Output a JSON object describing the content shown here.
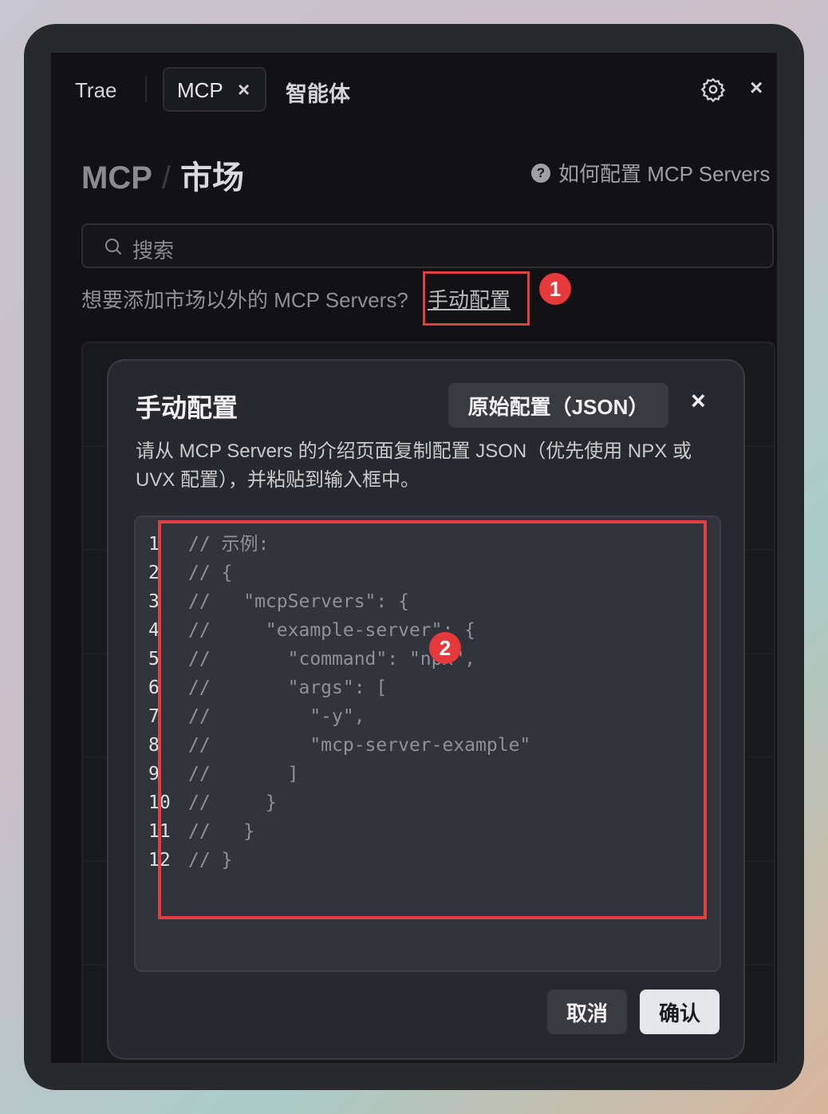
{
  "tabs": {
    "trae": "Trae",
    "mcp": "MCP",
    "mcp_close": "×",
    "agent": "智能体"
  },
  "window": {
    "close": "×"
  },
  "heading": {
    "mcp": "MCP",
    "separator": "/",
    "market": "市场"
  },
  "help": {
    "icon": "?",
    "label": "如何配置 MCP Servers"
  },
  "search": {
    "placeholder": "搜索"
  },
  "hint": {
    "text": "想要添加市场以外的 MCP Servers?",
    "link": "手动配置"
  },
  "annotations": {
    "badge1": "1",
    "badge2": "2",
    "highlight_color": "#e0413f"
  },
  "dialog": {
    "title": "手动配置",
    "raw_button": "原始配置（JSON）",
    "close": "×",
    "description": "请从 MCP Servers 的介绍页面复制配置 JSON（优先使用 NPX 或 UVX 配置），并粘贴到输入框中。",
    "code_lines": [
      {
        "n": "1",
        "text": "// 示例:"
      },
      {
        "n": "2",
        "text": "// {"
      },
      {
        "n": "3",
        "text": "//   \"mcpServers\": {"
      },
      {
        "n": "4",
        "text": "//     \"example-server\": {"
      },
      {
        "n": "5",
        "text": "//       \"command\": \"npx\","
      },
      {
        "n": "6",
        "text": "//       \"args\": ["
      },
      {
        "n": "7",
        "text": "//         \"-y\","
      },
      {
        "n": "8",
        "text": "//         \"mcp-server-example\""
      },
      {
        "n": "9",
        "text": "//       ]"
      },
      {
        "n": "10",
        "text": "//     }"
      },
      {
        "n": "11",
        "text": "//   }"
      },
      {
        "n": "12",
        "text": "// }"
      }
    ],
    "cancel": "取消",
    "confirm": "确认"
  }
}
